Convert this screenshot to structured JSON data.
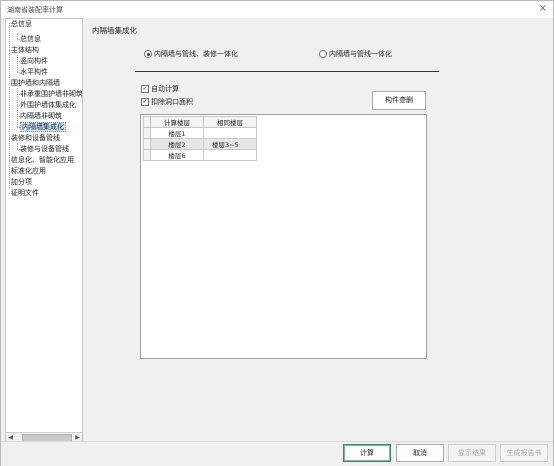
{
  "window": {
    "title": "湖南省装配率计算",
    "close_symbol": "×"
  },
  "tree": {
    "items": [
      {
        "label": "总信息"
      },
      {
        "label": "总信息"
      },
      {
        "label": "主体结构"
      },
      {
        "label": "竖向构件"
      },
      {
        "label": "水平构件"
      },
      {
        "label": "围护墙和内隔墙"
      },
      {
        "label": "非承重围护墙非砌筑"
      },
      {
        "label": "外围护墙体集成化"
      },
      {
        "label": "内隔墙非砌筑"
      },
      {
        "label": "内隔墙集成化"
      },
      {
        "label": "装修和设备管线"
      },
      {
        "label": "装修与设备管线"
      },
      {
        "label": "信息化、智能化应用"
      },
      {
        "label": "标准化应用"
      },
      {
        "label": "加分项"
      },
      {
        "label": "证明文件"
      }
    ],
    "scroll_left": "◀",
    "scroll_right": "▶"
  },
  "main": {
    "title": "内隔墙集成化",
    "radio_options": [
      {
        "label": "内隔墙与管线、装修一体化",
        "selected": true
      },
      {
        "label": "内隔墙与管线一体化",
        "selected": false
      }
    ],
    "checkboxes": [
      {
        "label": "自动计算",
        "checked": true,
        "mark": "✓"
      },
      {
        "label": "扣除洞口面积",
        "checked": true,
        "mark": "✓"
      }
    ],
    "component_button": "构件查删",
    "grid": {
      "headers": [
        "计算楼层",
        "相同楼层"
      ],
      "rows": [
        {
          "floor": "楼层1",
          "same": ""
        },
        {
          "floor": "楼层2",
          "same": "楼层3~5"
        },
        {
          "floor": "楼层6",
          "same": ""
        }
      ]
    }
  },
  "footer": {
    "calculate": "计算",
    "cancel": "取消",
    "show_result": "显示结果",
    "generate_report": "生成报告书"
  }
}
